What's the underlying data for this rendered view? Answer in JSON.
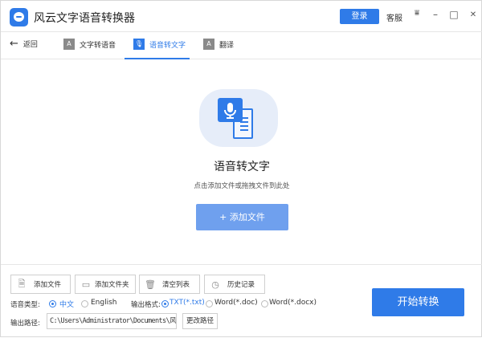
{
  "app": {
    "title": "风云文字语音转换器",
    "login": "登录",
    "service": "客服"
  },
  "window": {
    "menu_icon": "filter-icon",
    "minimize": "–",
    "maximize": "□",
    "close": "✕"
  },
  "nav": {
    "back": "返回",
    "tabs": [
      {
        "label": "文字转语音",
        "active": false
      },
      {
        "label": "语音转文字",
        "active": true
      },
      {
        "label": "翻译",
        "active": false
      }
    ]
  },
  "main": {
    "title": "语音转文字",
    "subtitle": "点击添加文件或拖拽文件到此处",
    "add_button": "+ 添加文件"
  },
  "toolbar": {
    "buttons": [
      "添加文件",
      "添加文件夹",
      "清空列表",
      "历史记录"
    ]
  },
  "options": {
    "voice_label": "语音类型:",
    "voice": [
      {
        "label": "中文",
        "selected": true
      },
      {
        "label": "English",
        "selected": false
      }
    ],
    "format_label": "输出格式:",
    "formats": [
      {
        "label": "TXT(*.txt)",
        "selected": true
      },
      {
        "label": "Word(*.doc)",
        "selected": false
      },
      {
        "label": "Word(*.docx)",
        "selected": false
      }
    ],
    "path_label": "输出路径:",
    "path": "C:\\Users\\Administrator\\Documents\\风云文字语音转换器",
    "change_path": "更改路径"
  },
  "start": "开始转换",
  "colors": {
    "accent": "#2f7be8",
    "add_button": "#6fa0ee"
  }
}
